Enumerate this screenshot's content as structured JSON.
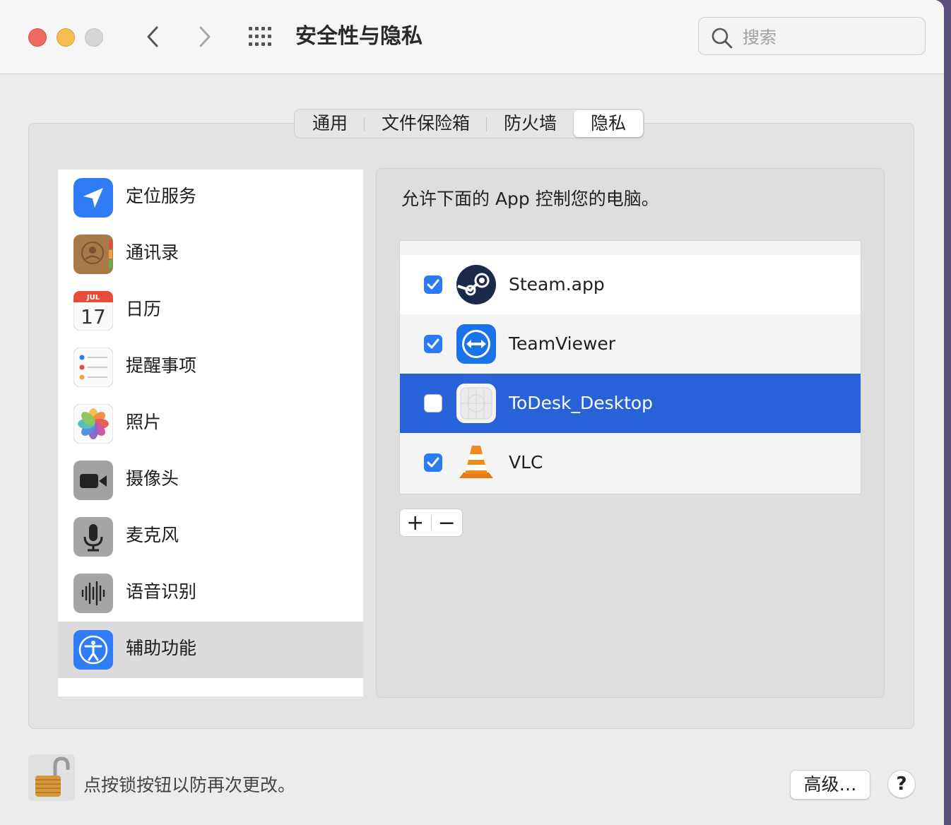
{
  "window": {
    "title": "安全性与隐私"
  },
  "search": {
    "placeholder": "搜索"
  },
  "tabs": [
    {
      "label": "通用"
    },
    {
      "label": "文件保险箱"
    },
    {
      "label": "防火墙"
    },
    {
      "label": "隐私",
      "active": true
    }
  ],
  "sidebar": {
    "items": [
      {
        "label": "定位服务",
        "icon": "location-icon"
      },
      {
        "label": "通讯录",
        "icon": "contacts-icon"
      },
      {
        "label": "日历",
        "icon": "calendar-icon",
        "icon_month": "JUL",
        "icon_day": "17"
      },
      {
        "label": "提醒事项",
        "icon": "reminders-icon"
      },
      {
        "label": "照片",
        "icon": "photos-icon"
      },
      {
        "label": "摄像头",
        "icon": "camera-icon"
      },
      {
        "label": "麦克风",
        "icon": "microphone-icon"
      },
      {
        "label": "语音识别",
        "icon": "speech-recognition-icon"
      },
      {
        "label": "辅助功能",
        "icon": "accessibility-icon",
        "selected": true
      }
    ]
  },
  "main": {
    "description": "允许下面的 App 控制您的电脑。",
    "apps": [
      {
        "name": "Steam.app",
        "checked": true,
        "icon": "steam-icon"
      },
      {
        "name": "TeamViewer",
        "checked": true,
        "icon": "teamviewer-icon"
      },
      {
        "name": "ToDesk_Desktop",
        "checked": false,
        "selected": true,
        "icon": "todesk-icon"
      },
      {
        "name": "VLC",
        "checked": true,
        "icon": "vlc-icon"
      }
    ],
    "add_label": "+",
    "remove_label": "−"
  },
  "footer": {
    "lock_text": "点按锁按钮以防再次更改。",
    "advanced_label": "高级…",
    "help_label": "?"
  },
  "colors": {
    "selection": "#2862d8",
    "checkbox": "#2a7bf2"
  }
}
